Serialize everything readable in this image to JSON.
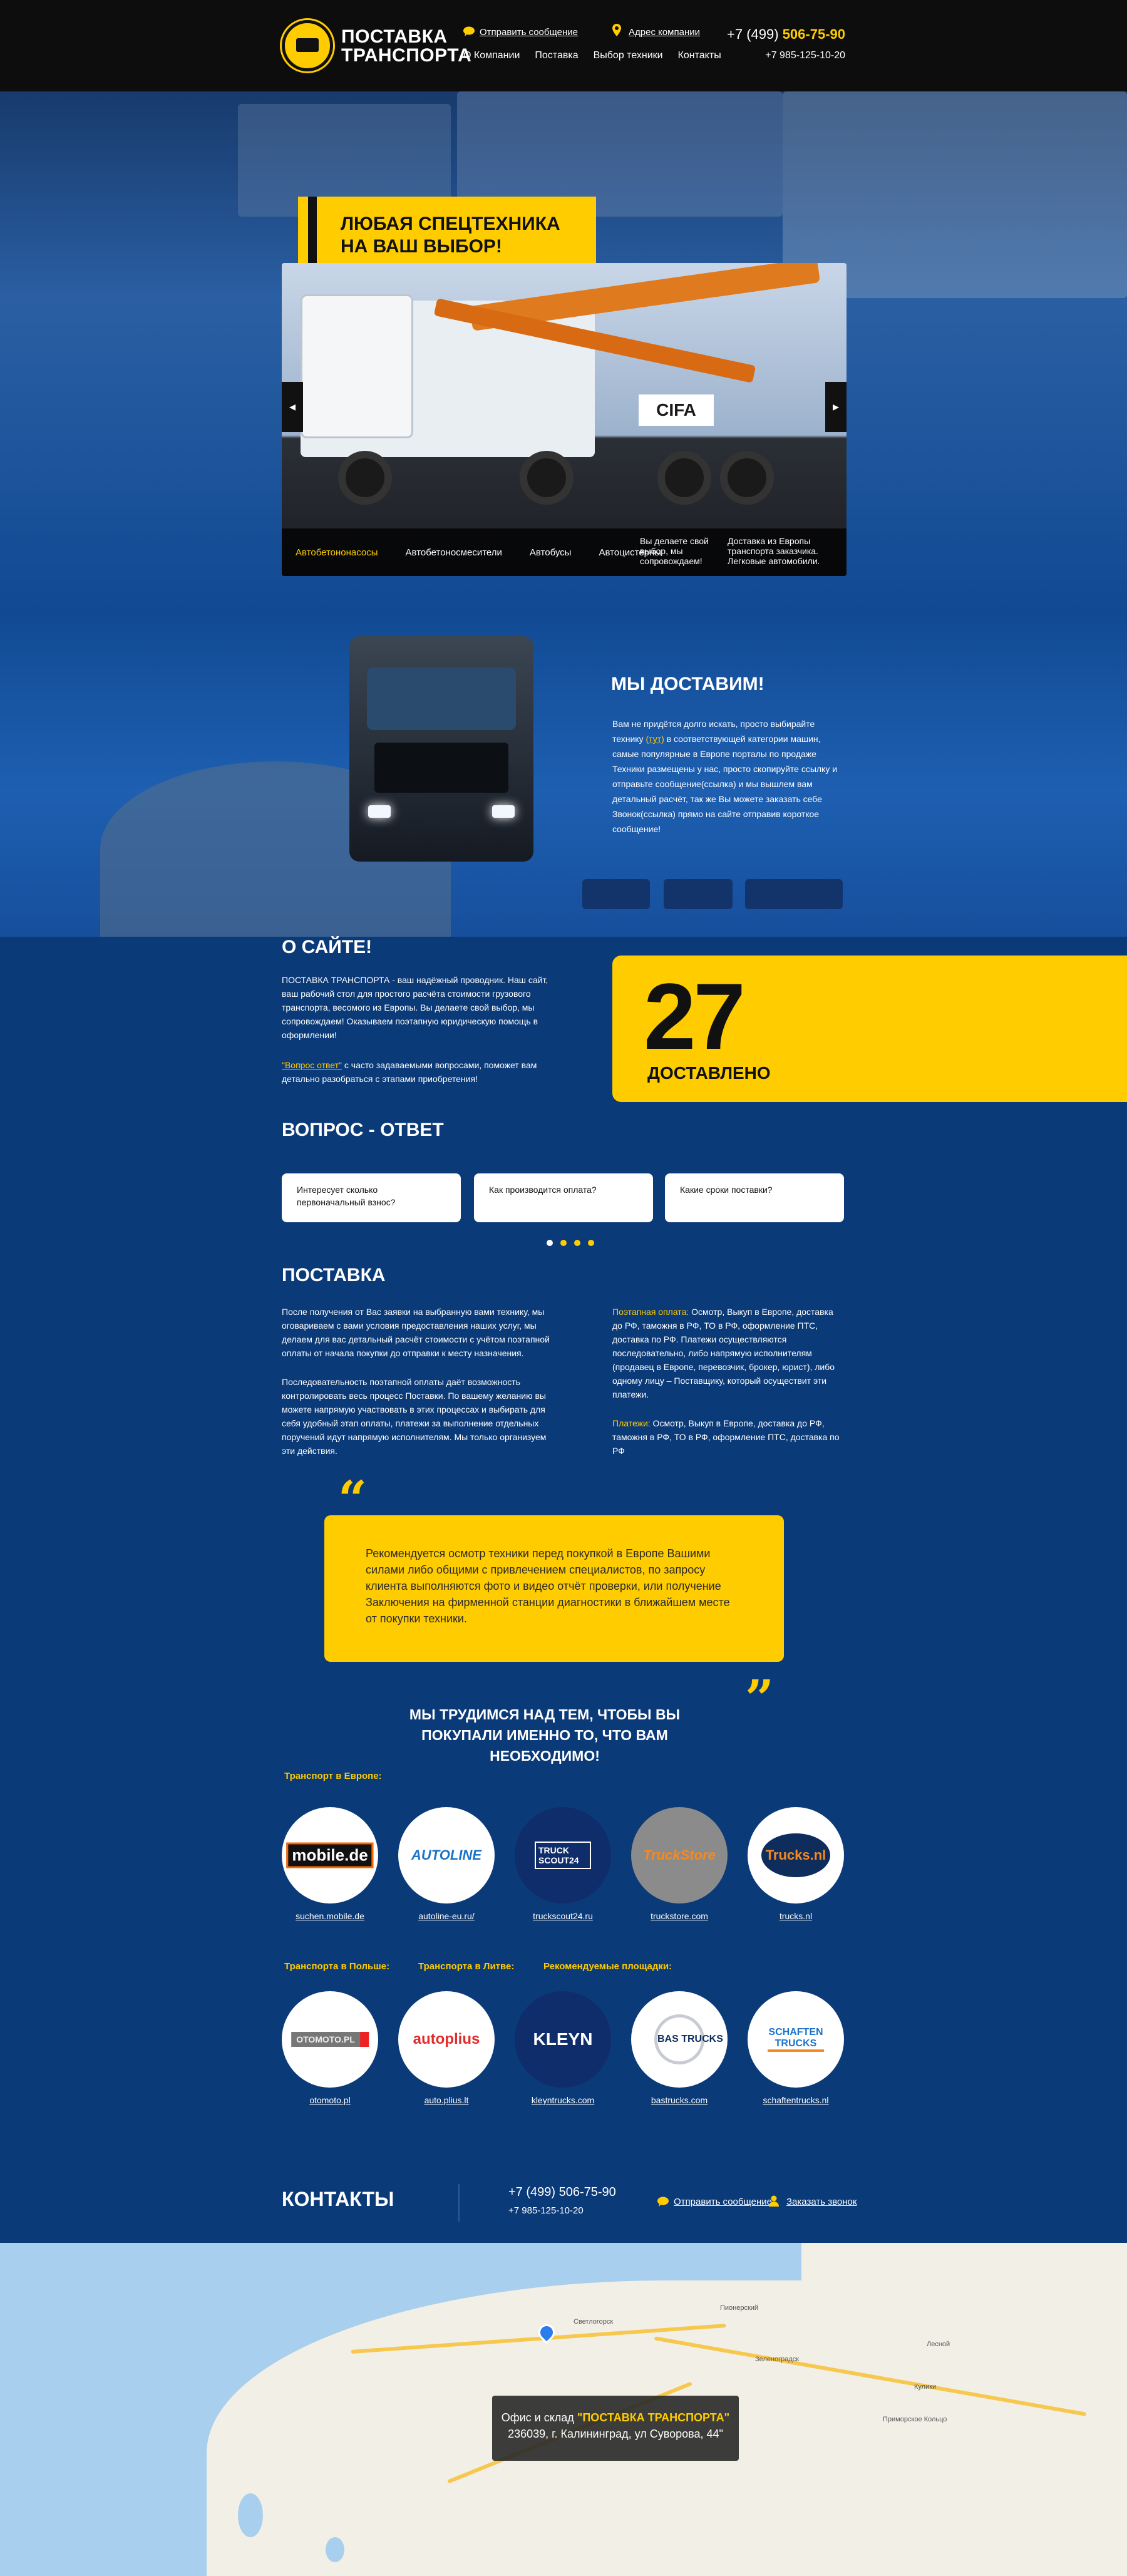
{
  "header": {
    "logo_line1": "ПОСТАВКА",
    "logo_line2": "ТРАНСПОРТА",
    "send_message": "Отправить сообщение",
    "company_address": "Адрес компании",
    "nav": [
      "О Компании",
      "Поставка",
      "Выбор техники",
      "Контакты"
    ],
    "phone_prefix": "+7 (499)",
    "phone_main": "506-75-90",
    "phone_alt": "+7 985-125-10-20"
  },
  "hero": {
    "badge_line1": "ЛЮБАЯ СПЕЦТЕХНИКА",
    "badge_line2": "НА ВАШ ВЫБОР!",
    "brand_text": "CIFA",
    "prev_arrow": "◂",
    "next_arrow": "▸",
    "tabs": [
      "Автобетононасосы",
      "Автобетоносмесители",
      "Автобусы",
      "Автоцистерны"
    ],
    "note1": "Вы делаете свой выбор, мы сопровождаем!",
    "note2": "Доставка из Европы транспорта заказчика. Легковые автомобили."
  },
  "deliver": {
    "title": "МЫ ДОСТАВИМ!",
    "text_a": "Вам не придётся долго искать, просто выбирайте технику",
    "text_link": "(тут)",
    "text_b": "в соответствующей категории машин, самые популярные в Европе порталы по продаже Техники размещены у нас, просто скопируйте ссылку и отправьте сообщение(ссылка) и мы вышлем вам детальный расчёт, так же Вы можете заказать себе Звонок(ссылка) прямо на сайте отправив короткое сообщение!"
  },
  "about": {
    "title": "О САЙТЕ!",
    "p1": "ПОСТАВКА ТРАНСПОРТА - ваш надёжный проводник. Наш сайт, ваш рабочий стол для простого расчёта стоимости грузового транспорта, весомого из Европы. Вы делаете свой выбор, мы сопровождаем! Оказываем поэтапную юридическую помощь в оформлении!",
    "p2_link": "\"Вопрос ответ\"",
    "p2_rest": " с часто задаваемыми вопросами, поможет вам детально разобраться с этапами приобретения!",
    "counter_value": "27",
    "counter_label": "ДОСТАВЛЕНО"
  },
  "faq": {
    "title": "ВОПРОС - ОТВЕТ",
    "cards": [
      "Интересует сколько первоначальный взнос?",
      "Как производится оплата?",
      "Какие сроки поставки?"
    ]
  },
  "supply": {
    "title": "ПОСТАВКА",
    "left_p1": "После получения от Вас заявки на выбранную вами технику, мы оговариваем с вами условия предоставления наших услуг, мы делаем для вас детальный расчёт стоимости с учётом поэтапной оплаты от начала покупки до отправки к месту назначения.",
    "left_p2": "Последовательность поэтапной оплаты даёт возможность контролировать весь процесс Поставки. По вашему желанию вы можете напрямую участвовать в этих процессах и выбирать для себя удобный этап оплаты, платежи за выполнение отдельных поручений идут напрямую исполнителям. Мы только организуем эти действия.",
    "right_h1": "Поэтапная оплата:",
    "right_p1": " Осмотр, Выкуп в Европе, доставка до РФ, таможня в РФ, ТО в РФ, оформление ПТС, доставка по РФ. Платежи осуществляются последовательно, либо напрямую исполнителям (продавец в Европе, перевозчик, брокер, юрист), либо одному лицу – Поставщику, который осуществит эти платежи.",
    "right_h2": "Платежи:",
    "right_p2": " Осмотр, Выкуп в Европе, доставка до РФ, таможня в РФ, ТО в РФ, оформление ПТС, доставка по РФ",
    "quote_open": "“",
    "quote_close": "”",
    "quote": "Рекомендуется осмотр техники перед покупкой в Европе Вашими силами либо общими с привлечением специалистов, по запросу клиента выполняются фото и видео отчёт проверки, или получение Заключения на фирменной станции диагностики в ближайшем месте от покупки техники.",
    "slogan": "МЫ ТРУДИМСЯ НАД ТЕМ, ЧТОБЫ ВЫ ПОКУПАЛИ ИМЕННО ТО, ЧТО ВАМ НЕОБХОДИМО!"
  },
  "sites": {
    "group_europe": "Транспорт в Европе:",
    "group_poland": "Транспорта в Польше:",
    "group_lithuania": "Транспорта в Литве:",
    "group_recommended": "Рекомендуемые площадки:",
    "row1": [
      {
        "label": "suchen.mobile.de",
        "brand": "mobile.de"
      },
      {
        "label": "autoline-eu.ru/",
        "brand": "AUTOLINE"
      },
      {
        "label": "truckscout24.ru",
        "brand": "TRUCK SCOUT24"
      },
      {
        "label": "truckstore.com",
        "brand": "TruckStore"
      },
      {
        "label": "trucks.nl",
        "brand": "Trucks.nl"
      }
    ],
    "row2": [
      {
        "label": "otomoto.pl",
        "brand": "OTOMOTO.PL"
      },
      {
        "label": "auto.plius.lt",
        "brand": "autoplius"
      },
      {
        "label": "kleyntrucks.com",
        "brand": "KLEYN"
      },
      {
        "label": "bastrucks.com",
        "brand": "BAS TRUCKS"
      },
      {
        "label": "schaftentrucks.nl",
        "brand": "SCHAFTEN TRUCKS"
      }
    ]
  },
  "contacts": {
    "title": "КОНТАКТЫ",
    "phone": "+7 (499) 506-75-90",
    "phone_alt": "+7 985-125-10-20",
    "send_message": "Отправить сообщение",
    "order_call": "Заказать звонок"
  },
  "map": {
    "office_prefix": "Офис и склад ",
    "office_name": "\"ПОСТАВКА ТРАНСПОРТА\"",
    "address": "236039, г. Калининград, ул Суворова, 44\"",
    "towns": [
      "Светлогорск",
      "Пионерский",
      "Зеленоградск",
      "Лесной",
      "Кулики",
      "Приморское Кольцо"
    ]
  },
  "colors": {
    "accent": "#ffcc00",
    "dark": "#0d0d0d",
    "blue": "#0b3a78"
  }
}
